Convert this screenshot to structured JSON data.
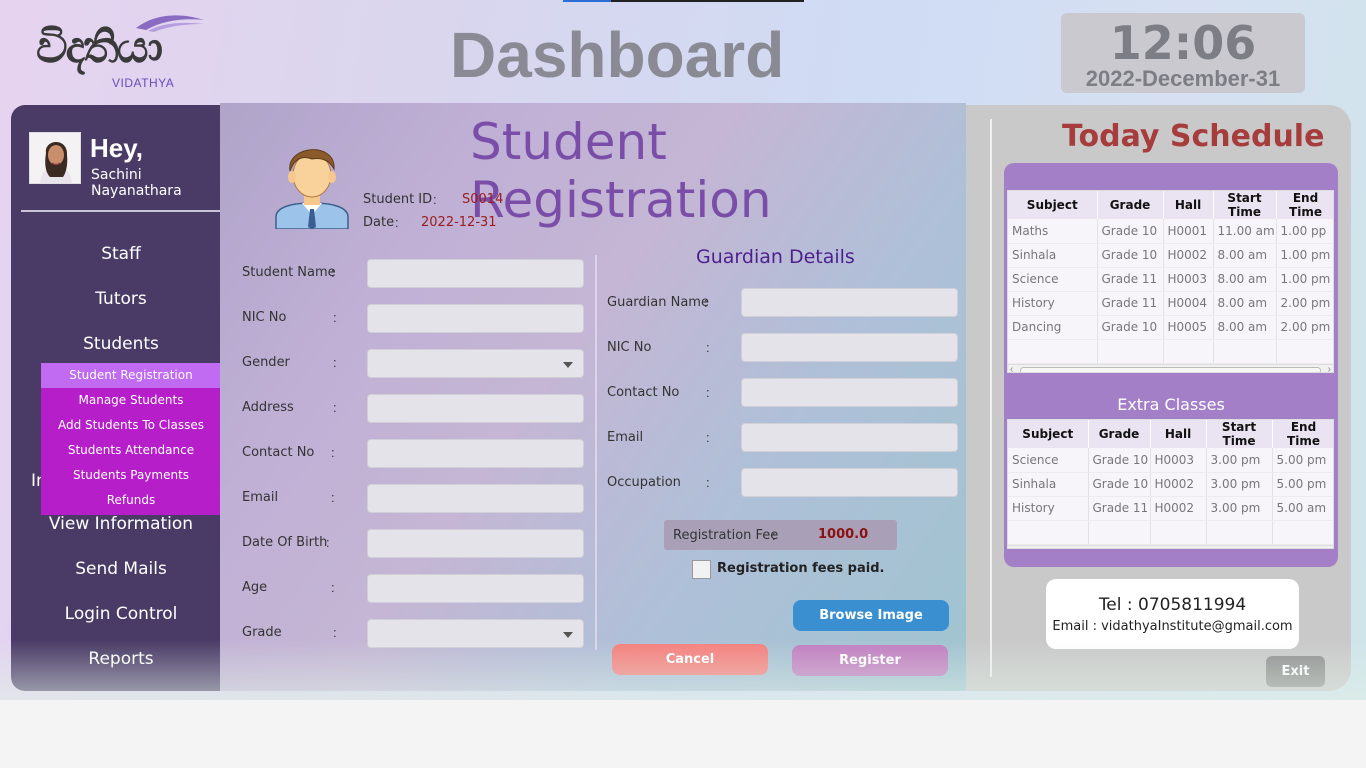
{
  "header": {
    "logo_script": "විදතියා",
    "logo_text": "VIDATHYA",
    "title": "Dashboard",
    "clock_time": "12:06",
    "clock_date": "2022-December-31"
  },
  "sidebar": {
    "greeting": "Hey,",
    "user_name": "Sachini Nayanathara",
    "items": [
      {
        "label": "Staff"
      },
      {
        "label": "Tutors"
      },
      {
        "label": "Students"
      },
      {
        "label": "View Information"
      },
      {
        "label": "Send Mails"
      },
      {
        "label": "Login Control"
      },
      {
        "label": "Reports"
      }
    ],
    "hidden_fragment": "In",
    "submenu": [
      {
        "label": "Student Registration",
        "active": true
      },
      {
        "label": "Manage Students"
      },
      {
        "label": "Add Students To Classes"
      },
      {
        "label": "Students Attendance"
      },
      {
        "label": "Students Payments"
      },
      {
        "label": "Refunds"
      }
    ]
  },
  "form": {
    "title": "Student Registration",
    "student_id_label": "Student ID",
    "student_id_value": "S0014",
    "date_label": "Date",
    "date_value": "2022-12-31",
    "fields": [
      {
        "label": "Student Name",
        "type": "text",
        "value": ""
      },
      {
        "label": "NIC No",
        "type": "text",
        "value": ""
      },
      {
        "label": "Gender",
        "type": "select",
        "value": ""
      },
      {
        "label": "Address",
        "type": "text",
        "value": ""
      },
      {
        "label": "Contact No",
        "type": "text",
        "value": ""
      },
      {
        "label": "Email",
        "type": "text",
        "value": ""
      },
      {
        "label": "Date Of Birth",
        "type": "text",
        "value": ""
      },
      {
        "label": "Age",
        "type": "text",
        "value": ""
      },
      {
        "label": "Grade",
        "type": "select",
        "value": ""
      }
    ],
    "guardian_title": "Guardian Details",
    "guardian_fields": [
      {
        "label": "Guardian Name",
        "value": ""
      },
      {
        "label": "NIC No",
        "value": ""
      },
      {
        "label": "Contact No",
        "value": ""
      },
      {
        "label": "Email",
        "value": ""
      },
      {
        "label": "Occupation",
        "value": ""
      }
    ],
    "registration_fee_label": "Registration Fee",
    "registration_fee_value": "1000.0",
    "fee_paid_label": "Registration fees paid.",
    "fee_paid_checked": false,
    "browse_label": "Browse Image",
    "cancel_label": "Cancel",
    "register_label": "Register"
  },
  "schedule": {
    "title": "Today Schedule",
    "columns": [
      "Subject",
      "Grade",
      "Hall",
      "Start Time",
      "End Time"
    ],
    "rows": [
      [
        "Maths",
        "Grade 10",
        "H0001",
        "11.00 am",
        "1.00 pp"
      ],
      [
        "Sinhala",
        "Grade 10",
        "H0002",
        "8.00 am",
        "1.00 pm"
      ],
      [
        "Science",
        "Grade 11",
        "H0003",
        "8.00 am",
        "1.00 pm"
      ],
      [
        "History",
        "Grade 11",
        "H0004",
        "8.00 am",
        "2.00 pm"
      ],
      [
        "Dancing",
        "Grade 10",
        "H0005",
        "8.00 am",
        "2.00 pm"
      ]
    ],
    "extra_title": "Extra Classes",
    "extra_columns": [
      "Subject",
      "Grade",
      "Hall",
      "Start Time",
      "End Time"
    ],
    "extra_rows": [
      [
        "Science",
        "Grade 10",
        "H0003",
        "3.00 pm",
        "5.00 pm"
      ],
      [
        "Sinhala",
        "Grade 10",
        "H0002",
        "3.00 pm",
        "5.00 pm"
      ],
      [
        "History",
        "Grade 11",
        "H0002",
        "3.00 pm",
        "5.00 am"
      ]
    ]
  },
  "contact": {
    "tel": "Tel  : 0705811994",
    "email": "Email : vidathyaInstitute@gmail.com"
  },
  "exit_label": "Exit",
  "colors": {
    "sidebar": "#4a3b66",
    "submenu": "#b51ec8",
    "submenu_active": "#c16af2",
    "title_purple": "#7a4ea8",
    "schedule_title": "#a73c3c",
    "browse": "#3a8fd0",
    "cancel": "#f57f7d",
    "register": "#c17ec0"
  }
}
